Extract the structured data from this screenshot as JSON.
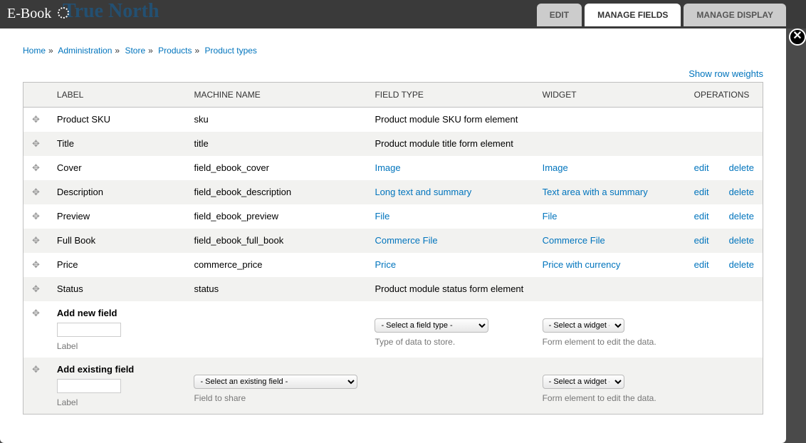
{
  "brand": "True North",
  "pageTitle": "E-Book",
  "tabs": {
    "edit": "EDIT",
    "manage_fields": "MANAGE FIELDS",
    "manage_display": "MANAGE DISPLAY"
  },
  "breadcrumb": {
    "home": "Home",
    "admin": "Administration",
    "store": "Store",
    "products": "Products",
    "types": "Product types"
  },
  "showWeights": "Show row weights",
  "headers": {
    "label": "LABEL",
    "machine": "MACHINE NAME",
    "type": "FIELD TYPE",
    "widget": "WIDGET",
    "ops": "OPERATIONS"
  },
  "rows": [
    {
      "label": "Product SKU",
      "machine": "sku",
      "type_text": "Product module SKU form element",
      "type_link": false,
      "widget_text": "",
      "widget_link": false,
      "ops": false
    },
    {
      "label": "Title",
      "machine": "title",
      "type_text": "Product module title form element",
      "type_link": false,
      "widget_text": "",
      "widget_link": false,
      "ops": false
    },
    {
      "label": "Cover",
      "machine": "field_ebook_cover",
      "type_text": "Image",
      "type_link": true,
      "widget_text": "Image",
      "widget_link": true,
      "ops": true
    },
    {
      "label": "Description",
      "machine": "field_ebook_description",
      "type_text": "Long text and summary",
      "type_link": true,
      "widget_text": "Text area with a summary",
      "widget_link": true,
      "ops": true
    },
    {
      "label": "Preview",
      "machine": "field_ebook_preview",
      "type_text": "File",
      "type_link": true,
      "widget_text": "File",
      "widget_link": true,
      "ops": true
    },
    {
      "label": "Full Book",
      "machine": "field_ebook_full_book",
      "type_text": "Commerce File",
      "type_link": true,
      "widget_text": "Commerce File",
      "widget_link": true,
      "ops": true
    },
    {
      "label": "Price",
      "machine": "commerce_price",
      "type_text": "Price",
      "type_link": true,
      "widget_text": "Price with currency",
      "widget_link": true,
      "ops": true
    },
    {
      "label": "Status",
      "machine": "status",
      "type_text": "Product module status form element",
      "type_link": false,
      "widget_text": "",
      "widget_link": false,
      "ops": false
    }
  ],
  "ops": {
    "edit": "edit",
    "delete": "delete"
  },
  "addNew": {
    "title": "Add new field",
    "labelHelp": "Label",
    "typePlaceholder": "- Select a field type -",
    "typeHelp": "Type of data to store.",
    "widgetPlaceholder": "- Select a widget -",
    "widgetHelp": "Form element to edit the data."
  },
  "addExisting": {
    "title": "Add existing field",
    "labelHelp": "Label",
    "fieldPlaceholder": "- Select an existing field -",
    "fieldHelp": "Field to share",
    "widgetPlaceholder": "- Select a widget -",
    "widgetHelp": "Form element to edit the data."
  }
}
